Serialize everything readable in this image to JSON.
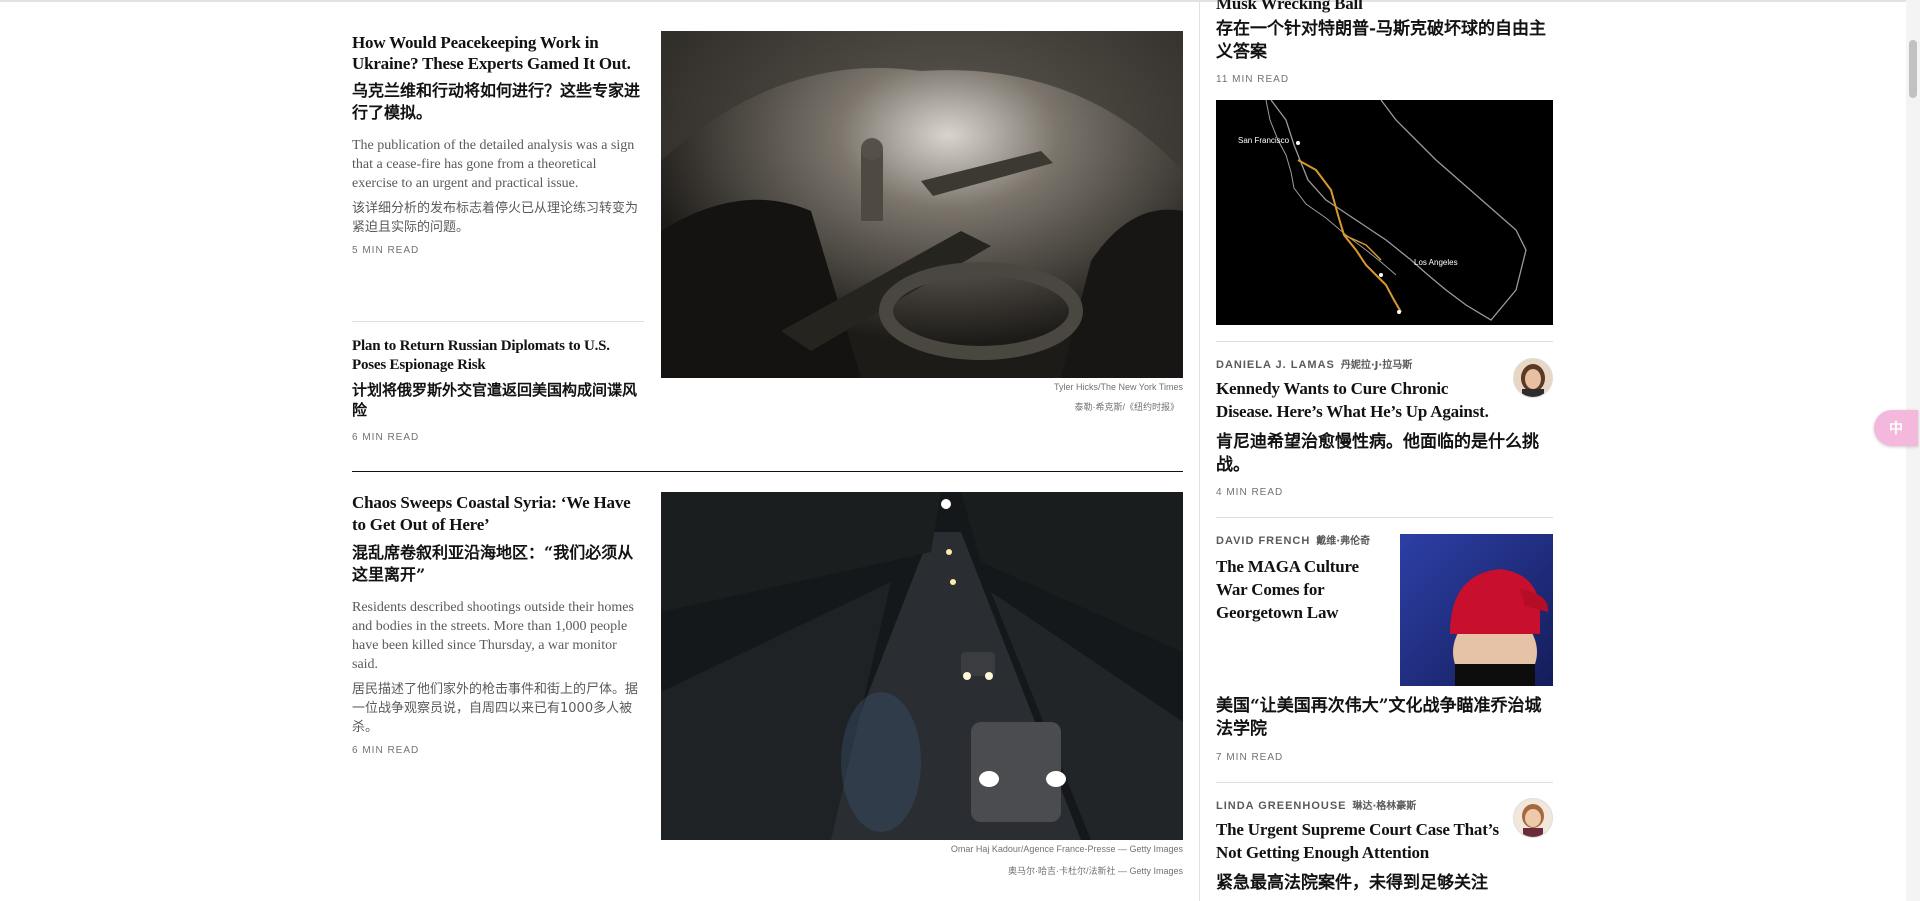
{
  "main": {
    "story1": {
      "headline_en": "How Would Peacekeeping Work in Ukraine? These Experts Gamed It Out.",
      "headline_zh": "乌克兰维和行动将如何进行？这些专家进行了模拟。",
      "summary_en": "The publication of the detailed analysis was a sign that a cease-fire has gone from a theoretical exercise to an urgent and practical issue.",
      "summary_zh": "该详细分析的发布标志着停火已从理论练习转变为紧迫且实际的问题。",
      "read_time": "5 MIN READ"
    },
    "story2": {
      "headline_en": "Plan to Return Russian Diplomats to U.S. Poses Espionage Risk",
      "headline_zh": "计划将俄罗斯外交官遣返回美国构成间谍风险",
      "read_time": "6 MIN READ"
    },
    "photo1": {
      "credit_en": "Tyler Hicks/The New York Times",
      "credit_zh": "泰勒·希克斯/《纽约时报》"
    },
    "story3": {
      "headline_en": "Chaos Sweeps Coastal Syria: ‘We Have to Get Out of Here’",
      "headline_zh": "混乱席卷叙利亚沿海地区：“我们必须从这里离开”",
      "summary_en": "Residents described shootings outside their homes and bodies in the streets. More than 1,000 people have been killed since Thursday, a war monitor said.",
      "summary_zh": "居民描述了他们家外的枪击事件和街上的尸体。据一位战争观察员说，自周四以来已有1000多人被杀。",
      "read_time": "6 MIN READ"
    },
    "photo2": {
      "credit_en": "Omar Haj Kadour/Agence France-Presse — Getty Images",
      "credit_zh": "奥马尔·哈吉·卡杜尔/法新社 — Getty Images"
    }
  },
  "opinion": {
    "top": {
      "headline_en_partial": "Musk Wrecking Ball",
      "headline_zh": "存在一个针对特朗普-马斯克破坏球的自由主义答案",
      "read_time": "11 MIN READ"
    },
    "map": {
      "label_sf": "San Francisco",
      "label_la": "Los Angeles"
    },
    "lamas": {
      "byline": "DANIELA J. LAMAS",
      "byline_zh": "丹妮拉·J·拉马斯",
      "headline_en": "Kennedy Wants to Cure Chronic Disease. Here’s What He’s Up Against.",
      "headline_zh": "肯尼迪希望治愈慢性病。他面临的是什么挑战。",
      "read_time": "4 MIN READ"
    },
    "french": {
      "byline": "DAVID FRENCH",
      "byline_zh": "戴维·弗伦奇",
      "headline_en": "The MAGA Culture War Comes for Georgetown Law",
      "headline_zh": "美国“让美国再次伟大”文化战争瞄准乔治城法学院",
      "read_time": "7 MIN READ"
    },
    "greenhouse": {
      "byline": "LINDA GREENHOUSE",
      "byline_zh": "琳达·格林豪斯",
      "headline_en": "The Urgent Supreme Court Case That’s Not Getting Enough Attention",
      "headline_zh": "紧急最高法院案件，未得到足够关注"
    }
  },
  "colors": {
    "text": "#121212",
    "muted": "#5a5a5a",
    "rule": "#dfdfdf",
    "map_route": "#d99a2b",
    "maga_hat": "#c8102e",
    "translate_button": "#f3b8dc"
  },
  "widgets": {
    "translate_icon": "translate-icon",
    "translate_label": "中"
  }
}
